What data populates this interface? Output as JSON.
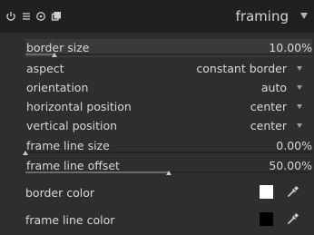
{
  "header": {
    "title": "framing",
    "icons": [
      "power-icon",
      "presets-icon",
      "reset-icon",
      "multi-instance-icon",
      "collapse-icon"
    ]
  },
  "params": {
    "border_size": {
      "label": "border size",
      "value": "10.00%",
      "level": 0.1
    },
    "aspect": {
      "label": "aspect",
      "value": "constant border"
    },
    "orientation": {
      "label": "orientation",
      "value": "auto"
    },
    "horizontal_position": {
      "label": "horizontal position",
      "value": "center"
    },
    "vertical_position": {
      "label": "vertical position",
      "value": "center"
    },
    "frame_line_size": {
      "label": "frame line size",
      "value": "0.00%",
      "level": 0.0
    },
    "frame_line_offset": {
      "label": "frame line offset",
      "value": "50.00%",
      "level": 0.5
    }
  },
  "colors": {
    "border_color": {
      "label": "border color",
      "swatch": "#ffffff"
    },
    "frame_line_color": {
      "label": "frame line color",
      "swatch": "#000000"
    }
  },
  "theme": {
    "accent": "#d6d6d6",
    "header_bg": "#202020",
    "panel_bg": "#2e2e2e"
  }
}
